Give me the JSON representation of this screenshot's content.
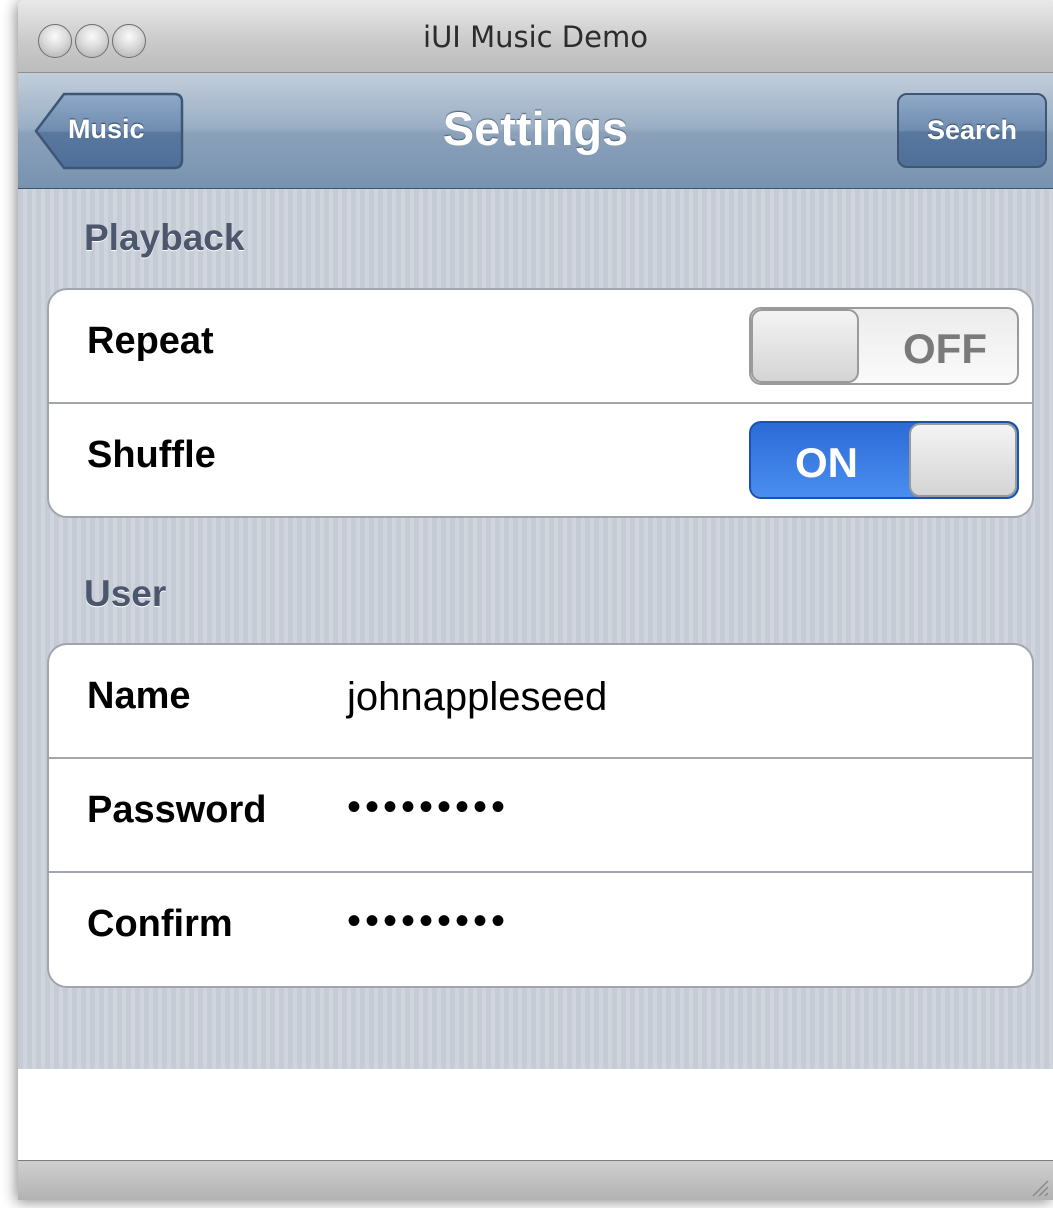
{
  "window": {
    "title": "iUI Music Demo",
    "controls": [
      "close-button",
      "minimize-button",
      "zoom-button"
    ]
  },
  "toolbar": {
    "title": "Settings",
    "back_label": "Music",
    "search_label": "Search"
  },
  "playback": {
    "heading": "Playback",
    "repeat": {
      "label": "Repeat",
      "state": "OFF"
    },
    "shuffle": {
      "label": "Shuffle",
      "state": "ON"
    }
  },
  "user": {
    "heading": "User",
    "name": {
      "label": "Name",
      "value": "johnappleseed"
    },
    "password": {
      "label": "Password",
      "value": "•••••••••"
    },
    "confirm": {
      "label": "Confirm",
      "value": "•••••••••"
    }
  },
  "colors": {
    "toolbar": "#8ba1ba",
    "toggle_on": "#2c6bd6",
    "section_heading": "#4c566c"
  },
  "icons": [
    "traffic-light-icon",
    "back-arrow-icon",
    "resize-grip-icon"
  ]
}
